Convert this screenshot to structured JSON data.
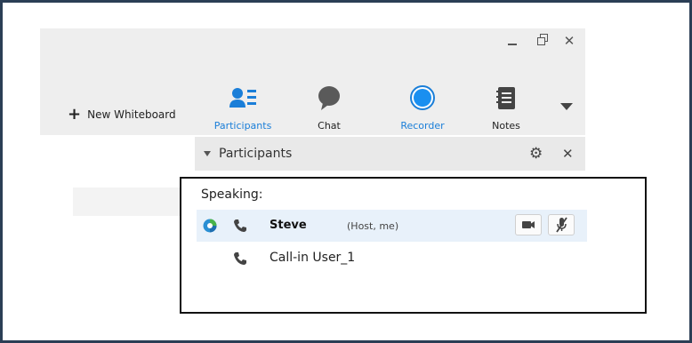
{
  "window": {
    "minimize_label": "_",
    "close_label": "✕"
  },
  "toolbar": {
    "new_whiteboard_label": "New Whiteboard",
    "new_whiteboard_plus": "+",
    "buttons": [
      {
        "label": "Participants",
        "icon": "participants-icon",
        "color": "#1a7ed8"
      },
      {
        "label": "Chat",
        "icon": "chat-bubble-icon",
        "color": "#555555"
      },
      {
        "label": "Recorder",
        "icon": "recorder-icon",
        "color": "#1a7ed8"
      },
      {
        "label": "Notes",
        "icon": "notes-icon",
        "color": "#444444"
      }
    ]
  },
  "panel": {
    "title": "Participants",
    "gear_icon": "⚙",
    "close_icon": "✕"
  },
  "participants": {
    "section_label": "Speaking:",
    "rows": [
      {
        "name": "Steve",
        "role": "(Host, me)",
        "icon": "webex-status-icon",
        "phone_icon": "phone-icon"
      },
      {
        "name": "Call-in User_1",
        "phone_icon": "phone-icon"
      }
    ]
  },
  "colors": {
    "accent": "#1a7ed8",
    "frame_border": "#2b3e55",
    "selected_row": "#e8f1fa"
  }
}
